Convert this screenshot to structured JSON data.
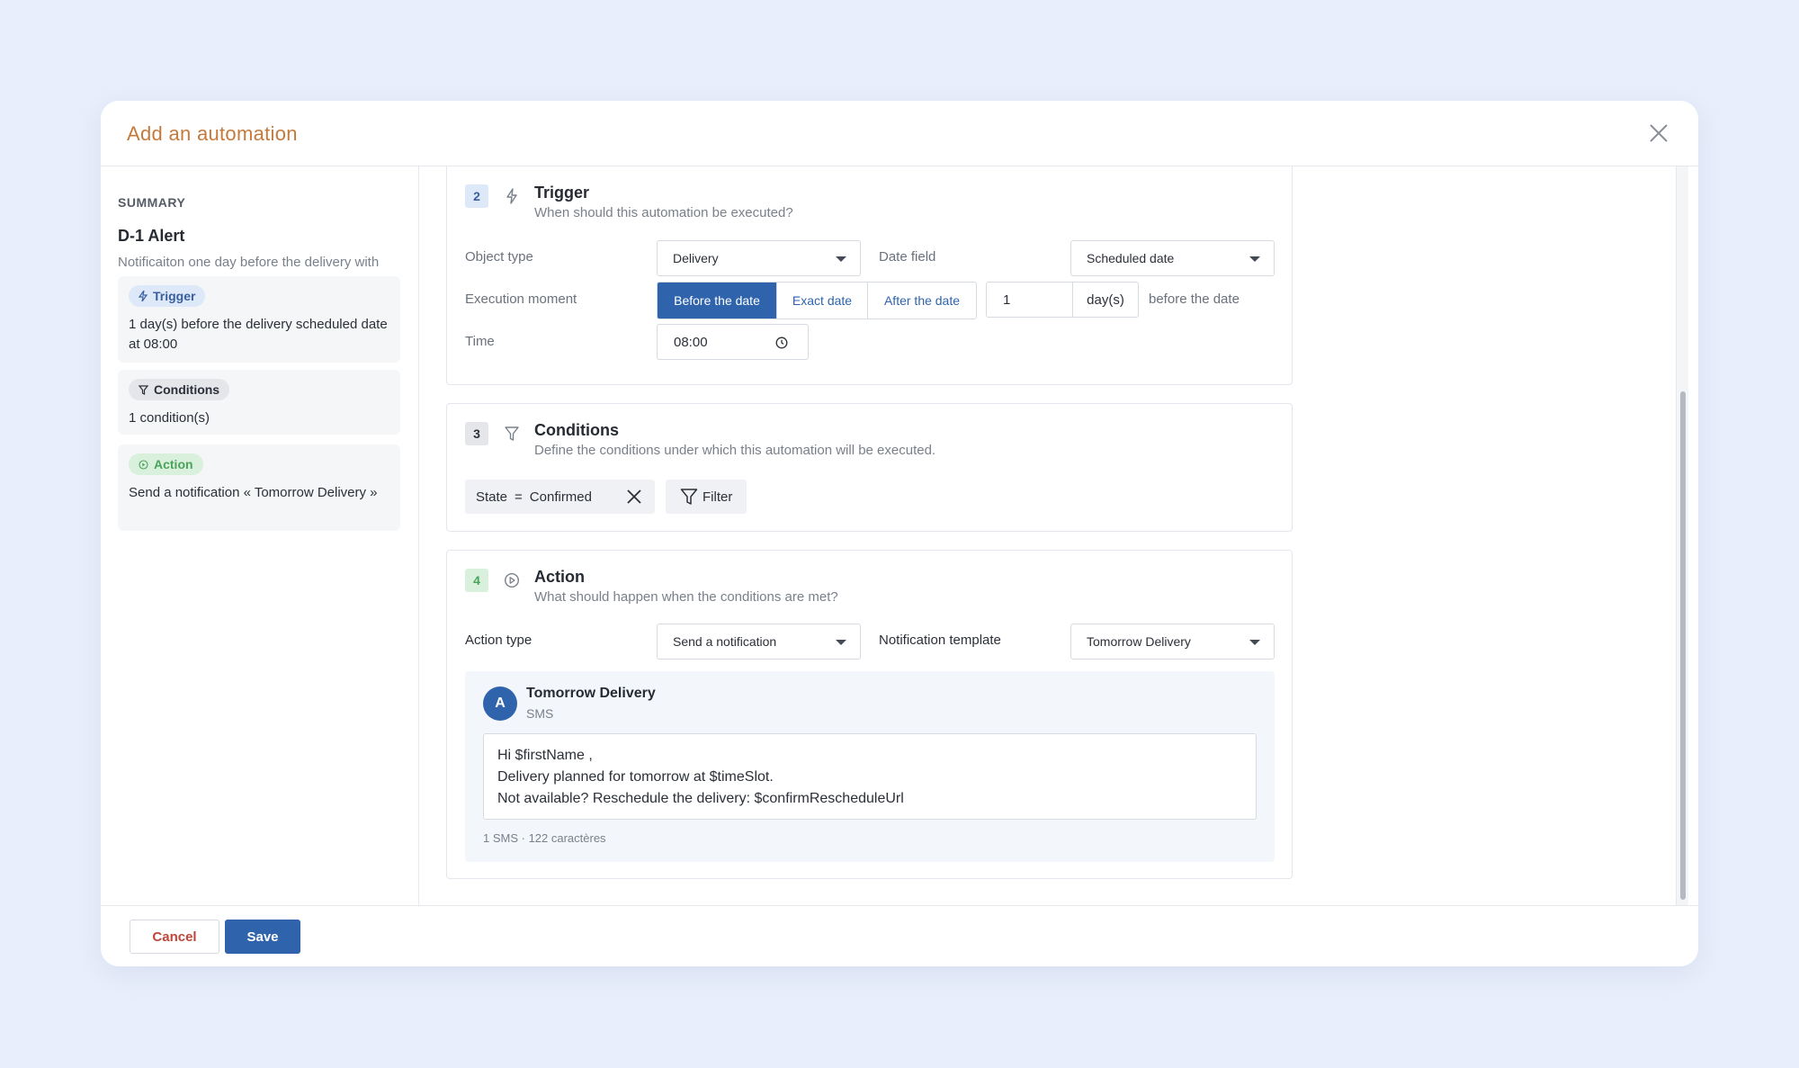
{
  "modal": {
    "title": "Add an automation"
  },
  "summary": {
    "label": "SUMMARY",
    "name": "D-1 Alert",
    "description": "Notificaiton one day before the delivery with rescheduling option.",
    "trigger": {
      "chip": "Trigger",
      "text": "1 day(s) before the delivery scheduled date at 08:00"
    },
    "conditions": {
      "chip": "Conditions",
      "text": "1 condition(s)"
    },
    "action": {
      "chip": "Action",
      "text": "Send a notification « Tomorrow Delivery »"
    }
  },
  "trigger": {
    "step": "2",
    "title": "Trigger",
    "subtitle": "When should this automation be executed?",
    "object_type_label": "Object type",
    "object_type_value": "Delivery",
    "date_field_label": "Date field",
    "date_field_value": "Scheduled date",
    "execution_label": "Execution moment",
    "options": [
      "Before the date",
      "Exact date",
      "After the date"
    ],
    "selected_option": "Before the date",
    "offset_value": "1",
    "offset_unit": "day(s)",
    "offset_suffix": "before the date",
    "time_label": "Time",
    "time_value": "08:00"
  },
  "conditions": {
    "step": "3",
    "title": "Conditions",
    "subtitle": "Define the conditions under which this automation will be executed.",
    "condition": {
      "field": "State",
      "operator": "=",
      "value": "Confirmed"
    },
    "filter_label": "Filter"
  },
  "action": {
    "step": "4",
    "title": "Action",
    "subtitle": "What should happen when the conditions are met?",
    "action_type_label": "Action type",
    "action_type_value": "Send a notification",
    "template_label": "Notification template",
    "template_value": "Tomorrow Delivery",
    "preview": {
      "avatar": "A",
      "title": "Tomorrow Delivery",
      "channel": "SMS",
      "lines": [
        "Hi $firstName ,",
        "Delivery planned for tomorrow at $timeSlot.",
        "Not available? Reschedule the delivery: $confirmRescheduleUrl"
      ],
      "count": "1 SMS · 122 caractères"
    }
  },
  "footer": {
    "cancel": "Cancel",
    "save": "Save"
  },
  "colors": {
    "accent": "#2f64ad",
    "title": "#c47a3c",
    "cancel": "#c0453a",
    "action_green": "#4aa35a"
  }
}
